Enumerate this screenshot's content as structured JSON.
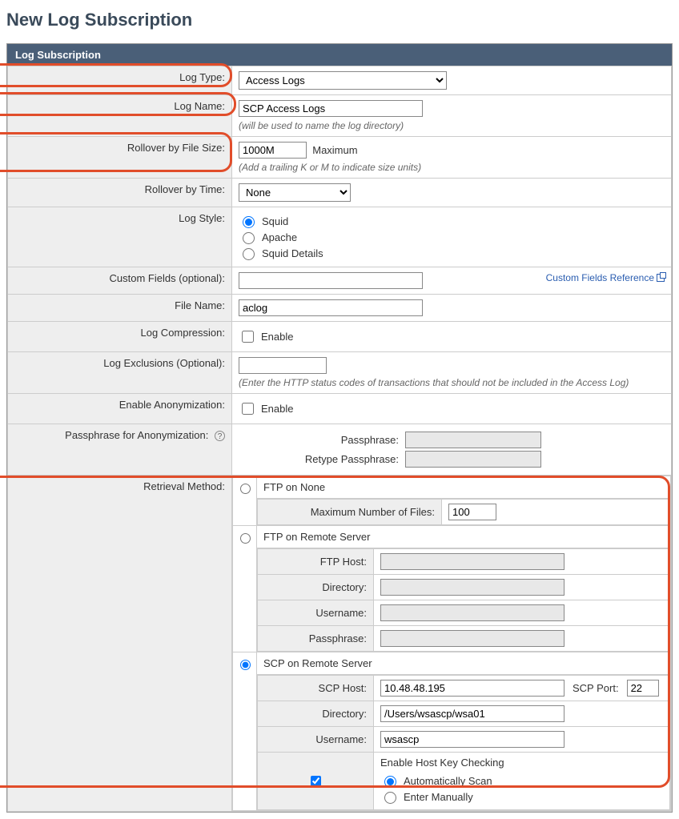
{
  "page_title": "New Log Subscription",
  "panel_title": "Log Subscription",
  "labels": {
    "log_type": "Log Type:",
    "log_name": "Log Name:",
    "rollover_size": "Rollover by File Size:",
    "rollover_time": "Rollover by Time:",
    "log_style": "Log Style:",
    "custom_fields": "Custom Fields (optional):",
    "file_name": "File Name:",
    "log_compression": "Log Compression:",
    "log_exclusions": "Log Exclusions (Optional):",
    "enable_anonymization": "Enable Anonymization:",
    "passphrase_anonymization": "Passphrase for Anonymization:",
    "retrieval_method": "Retrieval Method:"
  },
  "values": {
    "log_type_selected": "Access Logs",
    "log_name": "SCP Access Logs",
    "log_name_hint": "(will be used to name the log directory)",
    "rollover_size": "1000M",
    "rollover_size_after": "Maximum",
    "rollover_size_hint": "(Add a trailing K or M to indicate size units)",
    "rollover_time_selected": "None",
    "log_style_options": {
      "squid": "Squid",
      "apache": "Apache",
      "squid_details": "Squid Details"
    },
    "custom_fields_ref": "Custom Fields Reference",
    "file_name": "aclog",
    "enable_label": "Enable",
    "log_exclusions_hint": "(Enter the HTTP status codes of transactions that should not be included in the Access Log)",
    "passphrase_label": "Passphrase:",
    "retype_passphrase_label": "Retype Passphrase:"
  },
  "retrieval": {
    "ftp_none": {
      "title": "FTP on None",
      "max_files_label": "Maximum Number of Files:",
      "max_files": "100"
    },
    "ftp_remote": {
      "title": "FTP on Remote Server",
      "ftp_host_label": "FTP Host:",
      "directory_label": "Directory:",
      "username_label": "Username:",
      "passphrase_label": "Passphrase:"
    },
    "scp": {
      "title": "SCP on Remote Server",
      "scp_host_label": "SCP Host:",
      "scp_host": "10.48.48.195",
      "scp_port_label": "SCP Port:",
      "scp_port": "22",
      "directory_label": "Directory:",
      "directory": "/Users/wsascp/wsa01",
      "username_label": "Username:",
      "username": "wsascp",
      "host_key_check_label": "Enable Host Key Checking",
      "auto_scan": "Automatically Scan",
      "enter_manually": "Enter Manually"
    }
  }
}
